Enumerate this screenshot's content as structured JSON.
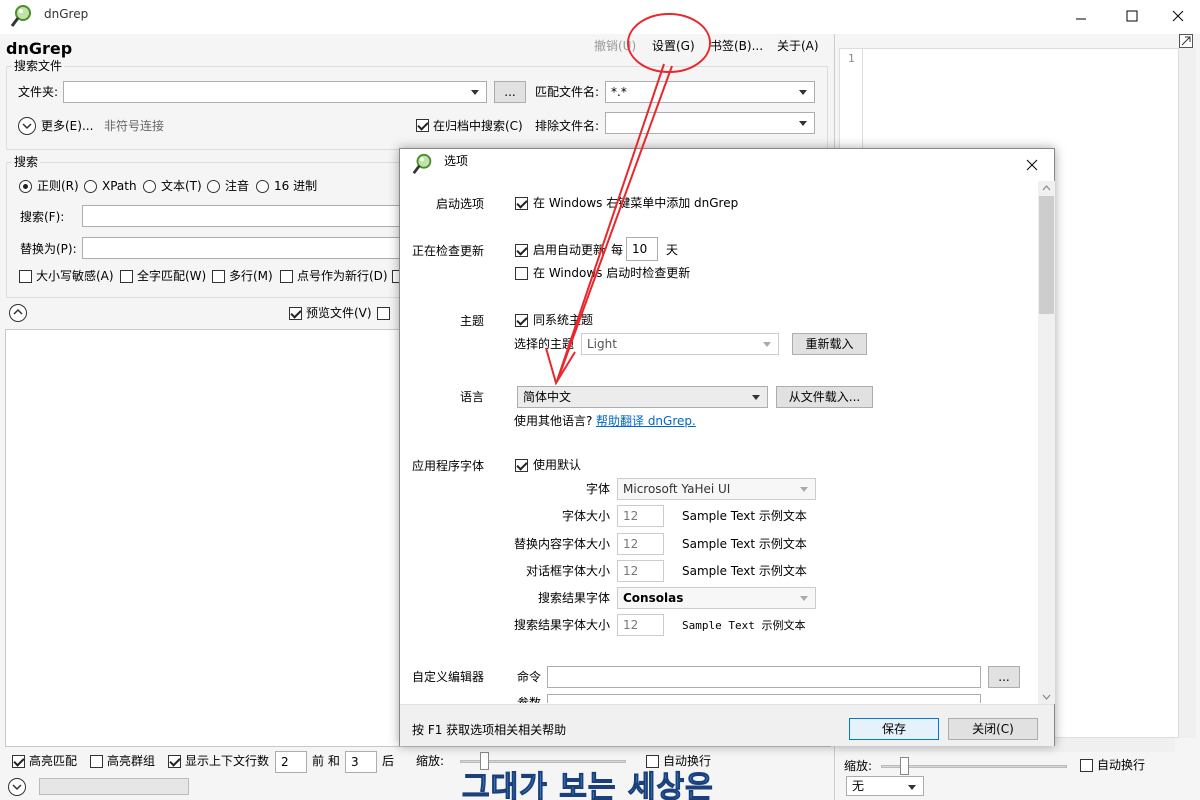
{
  "window": {
    "title": "dnGrep",
    "app_name": "dnGrep"
  },
  "menu": {
    "undo": "撤销(U)",
    "settings": "设置(G)",
    "bookmarks": "书签(B)...",
    "about": "关于(A)"
  },
  "search_files": {
    "group_label": "搜索文件",
    "folder_label": "文件夹:",
    "folder_value": "",
    "browse_label": "...",
    "pattern_label": "匹配文件名:",
    "pattern_value": "*.*",
    "more_label": "更多(E)...",
    "symlink_label": "非符号连接",
    "archives_label": "在归档中搜索(C)",
    "exclude_label": "排除文件名:",
    "exclude_value": ""
  },
  "search": {
    "group_label": "搜索",
    "types": [
      "正则(R)",
      "XPath",
      "文本(T)",
      "注音",
      "16 进制"
    ],
    "search_label": "搜索(F):",
    "replace_label": "替换为(P):",
    "options": [
      "大小写敏感(A)",
      "全字匹配(W)",
      "多行(M)",
      "点号作为新行(D)"
    ],
    "preview_label": "预览文件(V)"
  },
  "bottom_bar": {
    "highlight": "高亮匹配",
    "highlight_groups": "高亮群组",
    "show_context": "显示上下文行数",
    "before_value": "2",
    "before_label": "前 和",
    "after_value": "3",
    "after_label": "后",
    "zoom_label": "缩放:",
    "wrap_label": "自动换行"
  },
  "preview_pane": {
    "line_number": "1",
    "zoom_label": "缩放:",
    "wrap_label": "自动换行",
    "syntax_value": "无"
  },
  "overlay_text": "그대가 보는 세상은",
  "dialog": {
    "title": "选项",
    "startup_label": "启动选项",
    "startup_check": "在 Windows 右键菜单中添加 dnGrep",
    "update_label": "正在检查更新",
    "auto_update": "启用自动更新",
    "every_label": "每",
    "every_value": "10",
    "days_label": "天",
    "check_on_start": "在 Windows 启动时检查更新",
    "theme_label": "主题",
    "follow_system": "同系统主题",
    "selected_theme_label": "选择的主题",
    "theme_value": "Light",
    "reload_button": "重新载入",
    "language_label": "语言",
    "language_value": "简体中文",
    "load_from_file": "从文件载入...",
    "other_lang": "使用其他语言?",
    "help_translate": "帮助翻译 dnGrep.",
    "app_font_label": "应用程序字体",
    "use_default": "使用默认",
    "font_label": "字体",
    "font_value": "Microsoft YaHei UI",
    "font_size_label": "字体大小",
    "font_size_value": "12",
    "replace_font_size_label": "替换内容字体大小",
    "replace_font_size_value": "12",
    "dialog_font_size_label": "对话框字体大小",
    "dialog_font_size_value": "12",
    "result_font_label": "搜索结果字体",
    "result_font_value": "Consolas",
    "result_font_size_label": "搜索结果字体大小",
    "result_font_size_value": "12",
    "sample_text": "Sample Text 示例文本",
    "editor_label": "自定义编辑器",
    "command_label": "命令",
    "args_label": "参数",
    "browse_label": "...",
    "f1_help": "按 F1 获取选项相关相关帮助",
    "save_button": "保存",
    "close_button": "关闭(C)"
  },
  "colors": {
    "accent_annotation": "#e8282d",
    "link": "#0066cc",
    "focus_border": "#0078d7"
  }
}
